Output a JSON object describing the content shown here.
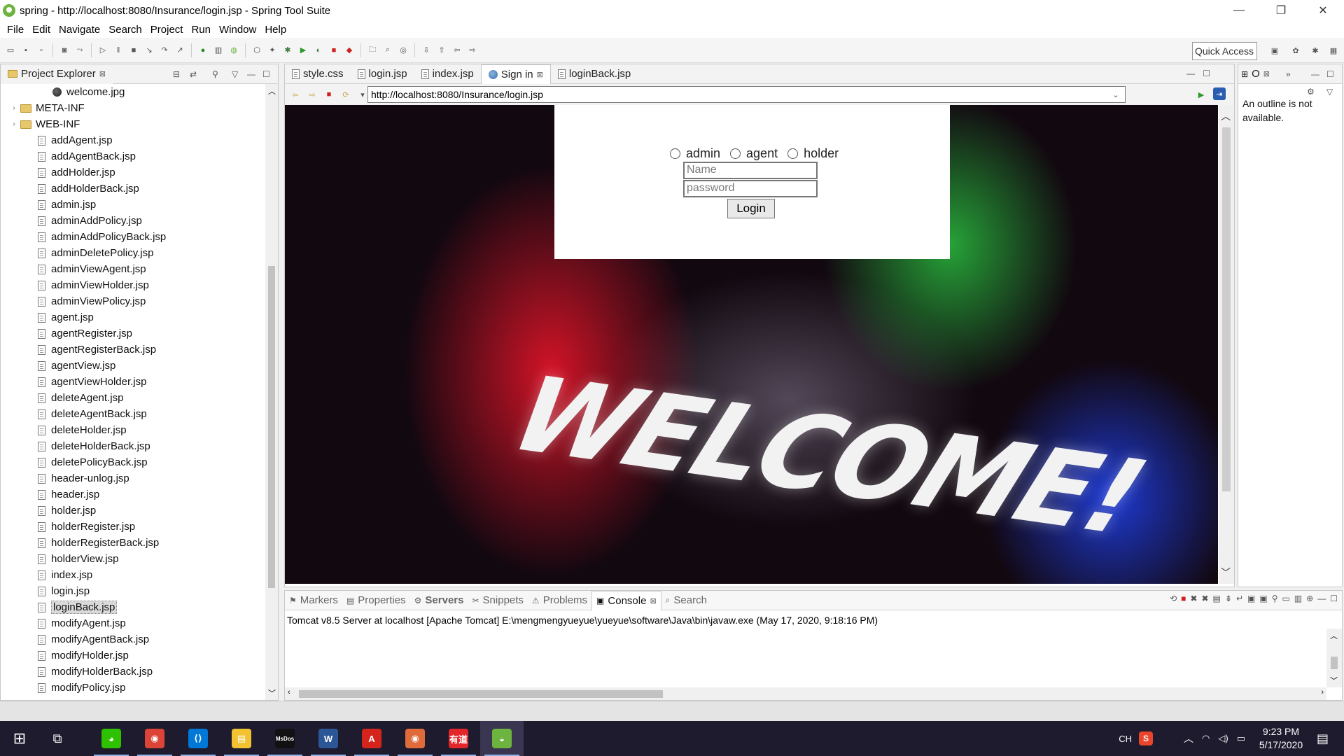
{
  "window": {
    "title": "spring - http://localhost:8080/Insurance/login.jsp - Spring Tool Suite",
    "minimize_glyph": "—",
    "maximize_glyph": "❐",
    "close_glyph": "✕"
  },
  "menu": [
    "File",
    "Edit",
    "Navigate",
    "Search",
    "Project",
    "Run",
    "Window",
    "Help"
  ],
  "toolbar": {
    "quick_access_placeholder": "Quick Access"
  },
  "project_explorer": {
    "title": "Project Explorer",
    "items": [
      {
        "label": "welcome.jpg",
        "type": "image",
        "indent": 3
      },
      {
        "label": "META-INF",
        "type": "folder",
        "indent": 1
      },
      {
        "label": "WEB-INF",
        "type": "folder",
        "indent": 1
      },
      {
        "label": "addAgent.jsp",
        "type": "file",
        "indent": 2
      },
      {
        "label": "addAgentBack.jsp",
        "type": "file",
        "indent": 2
      },
      {
        "label": "addHolder.jsp",
        "type": "file",
        "indent": 2
      },
      {
        "label": "addHolderBack.jsp",
        "type": "file",
        "indent": 2
      },
      {
        "label": "admin.jsp",
        "type": "file",
        "indent": 2
      },
      {
        "label": "adminAddPolicy.jsp",
        "type": "file",
        "indent": 2
      },
      {
        "label": "adminAddPolicyBack.jsp",
        "type": "file",
        "indent": 2
      },
      {
        "label": "adminDeletePolicy.jsp",
        "type": "file",
        "indent": 2
      },
      {
        "label": "adminViewAgent.jsp",
        "type": "file",
        "indent": 2
      },
      {
        "label": "adminViewHolder.jsp",
        "type": "file",
        "indent": 2
      },
      {
        "label": "adminViewPolicy.jsp",
        "type": "file",
        "indent": 2
      },
      {
        "label": "agent.jsp",
        "type": "file",
        "indent": 2
      },
      {
        "label": "agentRegister.jsp",
        "type": "file",
        "indent": 2
      },
      {
        "label": "agentRegisterBack.jsp",
        "type": "file",
        "indent": 2
      },
      {
        "label": "agentView.jsp",
        "type": "file",
        "indent": 2
      },
      {
        "label": "agentViewHolder.jsp",
        "type": "file",
        "indent": 2
      },
      {
        "label": "deleteAgent.jsp",
        "type": "file",
        "indent": 2
      },
      {
        "label": "deleteAgentBack.jsp",
        "type": "file",
        "indent": 2
      },
      {
        "label": "deleteHolder.jsp",
        "type": "file",
        "indent": 2
      },
      {
        "label": "deleteHolderBack.jsp",
        "type": "file",
        "indent": 2
      },
      {
        "label": "deletePolicyBack.jsp",
        "type": "file",
        "indent": 2
      },
      {
        "label": "header-unlog.jsp",
        "type": "file",
        "indent": 2
      },
      {
        "label": "header.jsp",
        "type": "file",
        "indent": 2
      },
      {
        "label": "holder.jsp",
        "type": "file",
        "indent": 2
      },
      {
        "label": "holderRegister.jsp",
        "type": "file",
        "indent": 2
      },
      {
        "label": "holderRegisterBack.jsp",
        "type": "file",
        "indent": 2
      },
      {
        "label": "holderView.jsp",
        "type": "file",
        "indent": 2
      },
      {
        "label": "index.jsp",
        "type": "file",
        "indent": 2
      },
      {
        "label": "login.jsp",
        "type": "file",
        "indent": 2
      },
      {
        "label": "loginBack.jsp",
        "type": "file",
        "indent": 2,
        "selected": true
      },
      {
        "label": "modifyAgent.jsp",
        "type": "file",
        "indent": 2
      },
      {
        "label": "modifyAgentBack.jsp",
        "type": "file",
        "indent": 2
      },
      {
        "label": "modifyHolder.jsp",
        "type": "file",
        "indent": 2
      },
      {
        "label": "modifyHolderBack.jsp",
        "type": "file",
        "indent": 2
      },
      {
        "label": "modifyPolicy.jsp",
        "type": "file",
        "indent": 2
      }
    ]
  },
  "editor_tabs": [
    {
      "label": "style.css",
      "icon": "file",
      "active": false
    },
    {
      "label": "login.jsp",
      "icon": "file",
      "active": false
    },
    {
      "label": "index.jsp",
      "icon": "file",
      "active": false
    },
    {
      "label": "Sign in",
      "icon": "globe",
      "active": true
    },
    {
      "label": "loginBack.jsp",
      "icon": "file",
      "active": false
    }
  ],
  "browser": {
    "url": "http://localhost:8080/Insurance/login.jsp",
    "page": {
      "roles": [
        "admin",
        "agent",
        "holder"
      ],
      "name_placeholder": "Name",
      "password_placeholder": "password",
      "login_label": "Login",
      "banner_text": "WELCOME!"
    }
  },
  "outline": {
    "tab_label": "O",
    "message": "An outline is not available."
  },
  "bottom_tabs": [
    {
      "label": "Markers",
      "active": false
    },
    {
      "label": "Properties",
      "active": false
    },
    {
      "label": "Servers",
      "active": false,
      "bold": true
    },
    {
      "label": "Snippets",
      "active": false
    },
    {
      "label": "Problems",
      "active": false
    },
    {
      "label": "Console",
      "active": true
    },
    {
      "label": "Search",
      "active": false
    }
  ],
  "console": {
    "header": "Tomcat v8.5 Server at localhost [Apache Tomcat] E:\\mengmengyueyue\\yueyue\\software\\Java\\bin\\javaw.exe (May 17, 2020, 9:18:16 PM)"
  },
  "taskbar": {
    "apps": [
      {
        "name": "wechat-icon",
        "color": "#2dc100",
        "glyph": "◕"
      },
      {
        "name": "chrome-icon",
        "color": "#db4437",
        "glyph": "◉"
      },
      {
        "name": "vscode-icon",
        "color": "#0078d7",
        "glyph": "⟨⟩"
      },
      {
        "name": "file-explorer-icon",
        "color": "#f2c230",
        "glyph": "▤"
      },
      {
        "name": "msdos-icon",
        "color": "#111111",
        "glyph": "MsDos"
      },
      {
        "name": "word-icon",
        "color": "#2b5797",
        "glyph": "W"
      },
      {
        "name": "acrobat-icon",
        "color": "#d4241c",
        "glyph": "A"
      },
      {
        "name": "chrome-alt-icon",
        "color": "#e06b3a",
        "glyph": "◉"
      },
      {
        "name": "youdao-icon",
        "color": "#e3262a",
        "glyph": "有道"
      },
      {
        "name": "spring-tool-suite-icon",
        "color": "#6db33f",
        "glyph": "◒"
      }
    ],
    "ime": "CH",
    "time": "9:23 PM",
    "date": "5/17/2020"
  },
  "colors": {
    "accent": "#6db33f",
    "taskbar": "#1f1b2e"
  }
}
